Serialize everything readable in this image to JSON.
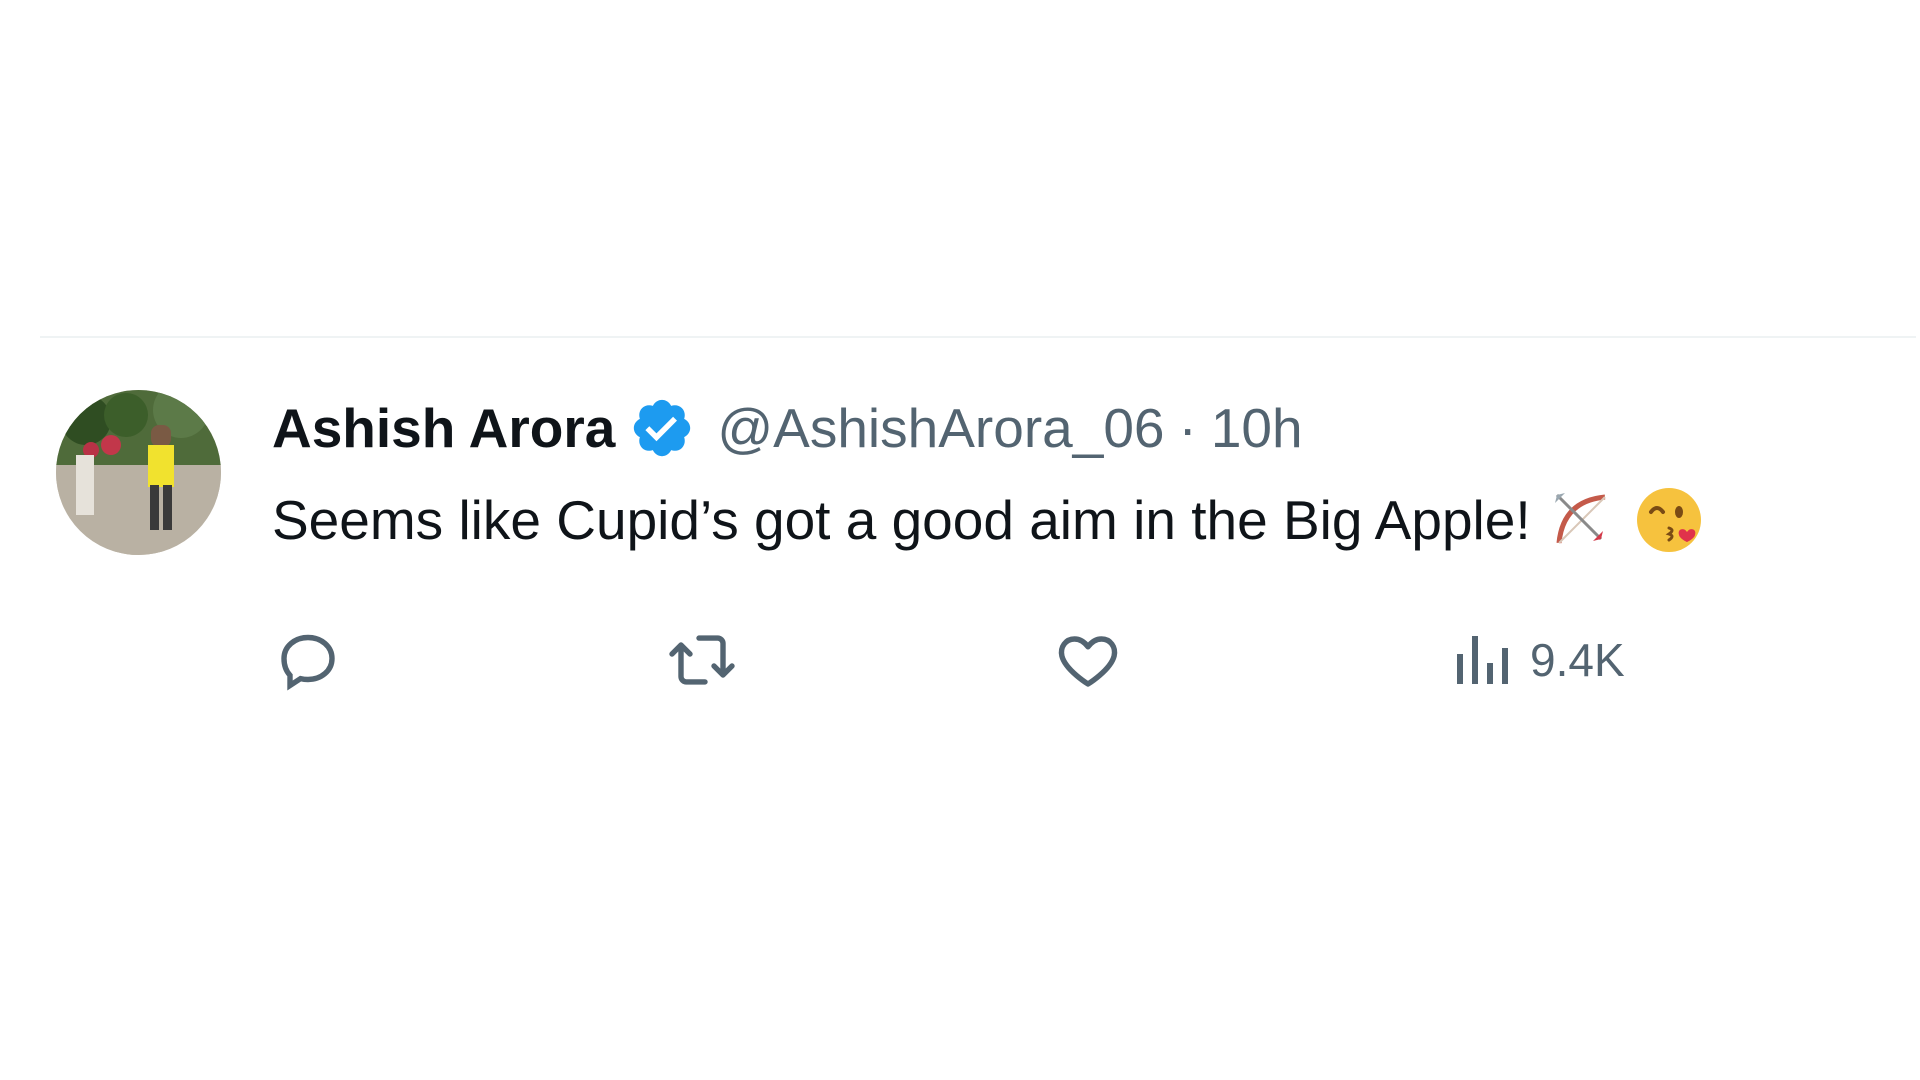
{
  "tweet": {
    "author_name": "Ashish Arora",
    "handle": "@AshishArora_06",
    "separator": "·",
    "time": "10h",
    "text": "Seems like Cupid’s got a good aim in the Big Apple!",
    "emojis": [
      "bow-and-arrow-emoji",
      "kissing-face-emoji"
    ]
  },
  "actions": {
    "reply_icon": "reply-icon",
    "retweet_icon": "retweet-icon",
    "like_icon": "heart-icon",
    "views_icon": "views-icon",
    "views_count": "9.4K"
  },
  "colors": {
    "text_primary": "#0f1419",
    "text_secondary": "#536471",
    "verified_blue": "#1d9bf0",
    "divider": "#eff3f4"
  }
}
